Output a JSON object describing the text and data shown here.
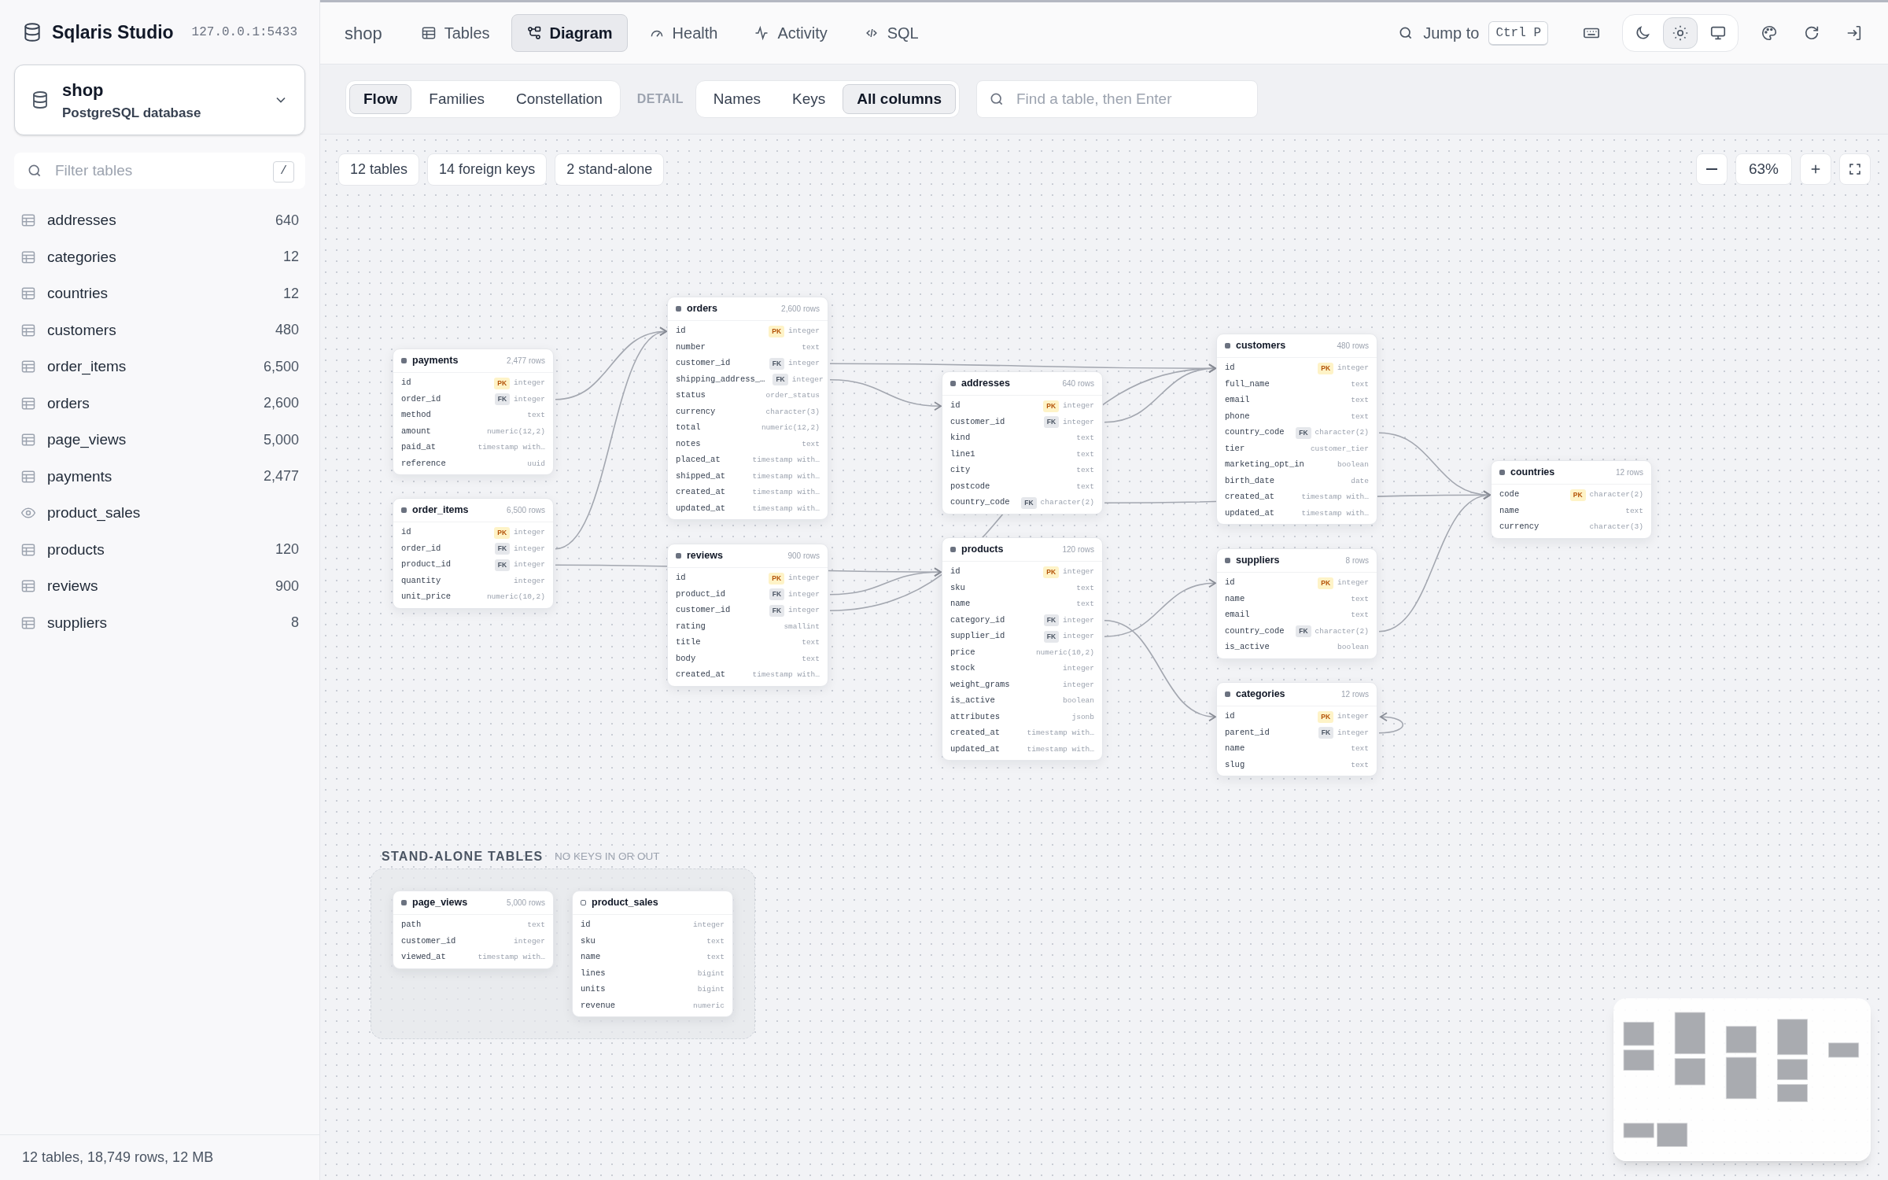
{
  "app": {
    "name": "Sqlaris Studio",
    "address": "127.0.0.1:5433"
  },
  "database": {
    "name": "shop",
    "engine": "PostgreSQL database"
  },
  "sidebar": {
    "filter_placeholder": "Filter tables",
    "filter_shortcut": "/",
    "items": [
      {
        "kind": "table",
        "name": "addresses",
        "count": "640"
      },
      {
        "kind": "table",
        "name": "categories",
        "count": "12"
      },
      {
        "kind": "table",
        "name": "countries",
        "count": "12"
      },
      {
        "kind": "table",
        "name": "customers",
        "count": "480"
      },
      {
        "kind": "table",
        "name": "order_items",
        "count": "6,500"
      },
      {
        "kind": "table",
        "name": "orders",
        "count": "2,600"
      },
      {
        "kind": "table",
        "name": "page_views",
        "count": "5,000"
      },
      {
        "kind": "table",
        "name": "payments",
        "count": "2,477"
      },
      {
        "kind": "view",
        "name": "product_sales"
      },
      {
        "kind": "table",
        "name": "products",
        "count": "120"
      },
      {
        "kind": "table",
        "name": "reviews",
        "count": "900"
      },
      {
        "kind": "table",
        "name": "suppliers",
        "count": "8"
      }
    ]
  },
  "status_bar": "12 tables, 18,749 rows, 12 MB",
  "breadcrumb": "shop",
  "tabs": [
    {
      "label": "Tables",
      "selected": false
    },
    {
      "label": "Diagram",
      "selected": true
    },
    {
      "label": "Health",
      "selected": false
    },
    {
      "label": "Activity",
      "selected": false
    },
    {
      "label": "SQL",
      "selected": false
    }
  ],
  "jump": {
    "label": "Jump to",
    "shortcut": "Ctrl P"
  },
  "theme_modes": [
    {
      "selected": false
    },
    {
      "selected": true
    },
    {
      "selected": false
    }
  ],
  "layouts": [
    {
      "label": "Flow",
      "selected": true
    },
    {
      "label": "Families",
      "selected": false
    },
    {
      "label": "Constellation",
      "selected": false
    }
  ],
  "detail_label": "DETAIL",
  "detail_levels": [
    {
      "label": "Names",
      "selected": false
    },
    {
      "label": "Keys",
      "selected": false
    },
    {
      "label": "All columns",
      "selected": true
    }
  ],
  "table_search": {
    "placeholder": "Find a table, then Enter"
  },
  "summary_chips": [
    "12 tables",
    "14 foreign keys",
    "2 stand-alone"
  ],
  "zoom_level": "63%",
  "diagram_tables": [
    {
      "kind": "table",
      "name": "payments",
      "rows": "2,477 rows",
      "columns": [
        {
          "name": "id",
          "key": "PK",
          "type": "integer"
        },
        {
          "name": "order_id",
          "key": "FK",
          "type": "integer"
        },
        {
          "name": "method",
          "type": "text"
        },
        {
          "name": "amount",
          "type": "numeric(12,2)"
        },
        {
          "name": "paid_at",
          "type": "timestamp with…"
        },
        {
          "name": "reference",
          "type": "uuid"
        }
      ]
    },
    {
      "kind": "table",
      "name": "order_items",
      "rows": "6,500 rows",
      "columns": [
        {
          "name": "id",
          "key": "PK",
          "type": "integer"
        },
        {
          "name": "order_id",
          "key": "FK",
          "type": "integer"
        },
        {
          "name": "product_id",
          "key": "FK",
          "type": "integer"
        },
        {
          "name": "quantity",
          "type": "integer"
        },
        {
          "name": "unit_price",
          "type": "numeric(10,2)"
        }
      ]
    },
    {
      "kind": "table",
      "name": "orders",
      "rows": "2,600 rows",
      "columns": [
        {
          "name": "id",
          "key": "PK",
          "type": "integer"
        },
        {
          "name": "number",
          "type": "text"
        },
        {
          "name": "customer_id",
          "key": "FK",
          "type": "integer"
        },
        {
          "name": "shipping_address_…",
          "key": "FK",
          "type": "integer"
        },
        {
          "name": "status",
          "type": "order_status"
        },
        {
          "name": "currency",
          "type": "character(3)"
        },
        {
          "name": "total",
          "type": "numeric(12,2)"
        },
        {
          "name": "notes",
          "type": "text"
        },
        {
          "name": "placed_at",
          "type": "timestamp with…"
        },
        {
          "name": "shipped_at",
          "type": "timestamp with…"
        },
        {
          "name": "created_at",
          "type": "timestamp with…"
        },
        {
          "name": "updated_at",
          "type": "timestamp with…"
        }
      ]
    },
    {
      "kind": "table",
      "name": "reviews",
      "rows": "900 rows",
      "columns": [
        {
          "name": "id",
          "key": "PK",
          "type": "integer"
        },
        {
          "name": "product_id",
          "key": "FK",
          "type": "integer"
        },
        {
          "name": "customer_id",
          "key": "FK",
          "type": "integer"
        },
        {
          "name": "rating",
          "type": "smallint"
        },
        {
          "name": "title",
          "type": "text"
        },
        {
          "name": "body",
          "type": "text"
        },
        {
          "name": "created_at",
          "type": "timestamp with…"
        }
      ]
    },
    {
      "kind": "table",
      "name": "addresses",
      "rows": "640 rows",
      "columns": [
        {
          "name": "id",
          "key": "PK",
          "type": "integer"
        },
        {
          "name": "customer_id",
          "key": "FK",
          "type": "integer"
        },
        {
          "name": "kind",
          "type": "text"
        },
        {
          "name": "line1",
          "type": "text"
        },
        {
          "name": "city",
          "type": "text"
        },
        {
          "name": "postcode",
          "type": "text"
        },
        {
          "name": "country_code",
          "key": "FK",
          "type": "character(2)"
        }
      ]
    },
    {
      "kind": "table",
      "name": "products",
      "rows": "120 rows",
      "columns": [
        {
          "name": "id",
          "key": "PK",
          "type": "integer"
        },
        {
          "name": "sku",
          "type": "text"
        },
        {
          "name": "name",
          "type": "text"
        },
        {
          "name": "category_id",
          "key": "FK",
          "type": "integer"
        },
        {
          "name": "supplier_id",
          "key": "FK",
          "type": "integer"
        },
        {
          "name": "price",
          "type": "numeric(10,2)"
        },
        {
          "name": "stock",
          "type": "integer"
        },
        {
          "name": "weight_grams",
          "type": "integer"
        },
        {
          "name": "is_active",
          "type": "boolean"
        },
        {
          "name": "attributes",
          "type": "jsonb"
        },
        {
          "name": "created_at",
          "type": "timestamp with…"
        },
        {
          "name": "updated_at",
          "type": "timestamp with…"
        }
      ]
    },
    {
      "kind": "table",
      "name": "customers",
      "rows": "480 rows",
      "columns": [
        {
          "name": "id",
          "key": "PK",
          "type": "integer"
        },
        {
          "name": "full_name",
          "type": "text"
        },
        {
          "name": "email",
          "type": "text"
        },
        {
          "name": "phone",
          "type": "text"
        },
        {
          "name": "country_code",
          "key": "FK",
          "type": "character(2)"
        },
        {
          "name": "tier",
          "type": "customer_tier"
        },
        {
          "name": "marketing_opt_in",
          "type": "boolean"
        },
        {
          "name": "birth_date",
          "type": "date"
        },
        {
          "name": "created_at",
          "type": "timestamp with…"
        },
        {
          "name": "updated_at",
          "type": "timestamp with…"
        }
      ]
    },
    {
      "kind": "table",
      "name": "suppliers",
      "rows": "8 rows",
      "columns": [
        {
          "name": "id",
          "key": "PK",
          "type": "integer"
        },
        {
          "name": "name",
          "type": "text"
        },
        {
          "name": "email",
          "type": "text"
        },
        {
          "name": "country_code",
          "key": "FK",
          "type": "character(2)"
        },
        {
          "name": "is_active",
          "type": "boolean"
        }
      ]
    },
    {
      "kind": "table",
      "name": "categories",
      "rows": "12 rows",
      "columns": [
        {
          "name": "id",
          "key": "PK",
          "type": "integer"
        },
        {
          "name": "parent_id",
          "key": "FK",
          "type": "integer"
        },
        {
          "name": "name",
          "type": "text"
        },
        {
          "name": "slug",
          "type": "text"
        }
      ]
    },
    {
      "kind": "table",
      "name": "countries",
      "rows": "12 rows",
      "columns": [
        {
          "name": "code",
          "key": "PK",
          "type": "character(2)"
        },
        {
          "name": "name",
          "type": "text"
        },
        {
          "name": "currency",
          "type": "character(3)"
        }
      ]
    }
  ],
  "standalone": {
    "title": "STAND-ALONE TABLES",
    "note": "NO KEYS IN OR OUT",
    "tables": [
      {
        "kind": "table",
        "name": "page_views",
        "rows": "5,000 rows",
        "columns": [
          {
            "name": "path",
            "type": "text"
          },
          {
            "name": "customer_id",
            "type": "integer"
          },
          {
            "name": "viewed_at",
            "type": "timestamp with…"
          }
        ]
      },
      {
        "kind": "view",
        "name": "product_sales",
        "columns": [
          {
            "name": "id",
            "type": "integer"
          },
          {
            "name": "sku",
            "type": "text"
          },
          {
            "name": "name",
            "type": "text"
          },
          {
            "name": "lines",
            "type": "bigint"
          },
          {
            "name": "units",
            "type": "bigint"
          },
          {
            "name": "revenue",
            "type": "numeric"
          }
        ]
      }
    ]
  }
}
